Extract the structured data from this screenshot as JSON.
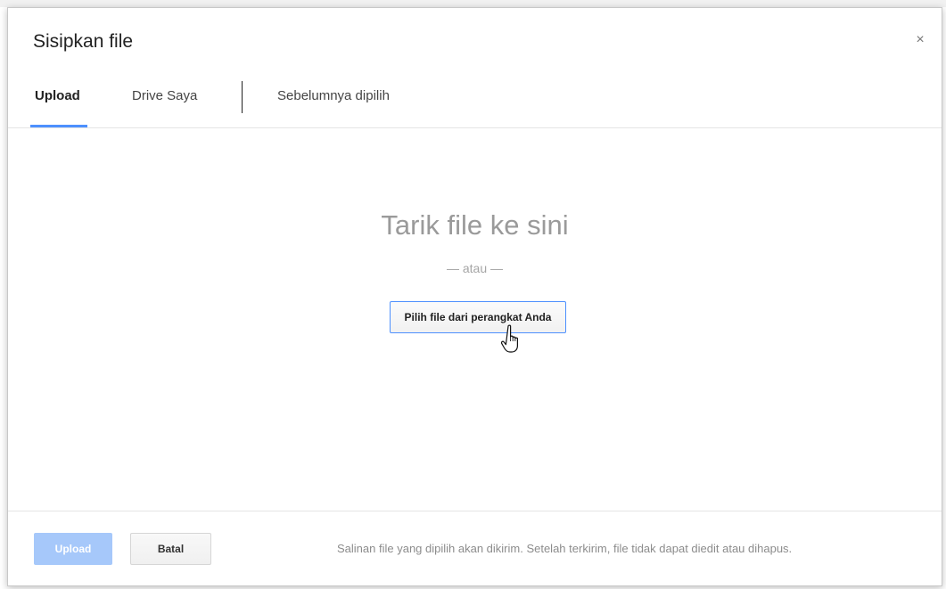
{
  "dialog": {
    "title": "Sisipkan file",
    "close_symbol": "×"
  },
  "tabs": [
    {
      "label": "Upload",
      "active": true
    },
    {
      "label": "Drive Saya",
      "active": false
    },
    {
      "label": "Sebelumnya dipilih",
      "active": false
    }
  ],
  "dropzone": {
    "title": "Tarik file ke sini",
    "or_text": "— atau —",
    "choose_label": "Pilih file dari perangkat Anda",
    "cursor_icon": "hand-pointer-icon"
  },
  "footer": {
    "upload_label": "Upload",
    "cancel_label": "Batal",
    "note": "Salinan file yang dipilih akan dikirim. Setelah terkirim, file tidak dapat diedit atau dihapus."
  },
  "colors": {
    "accent": "#4d90fe",
    "upload_disabled": "#a6c8fa"
  }
}
